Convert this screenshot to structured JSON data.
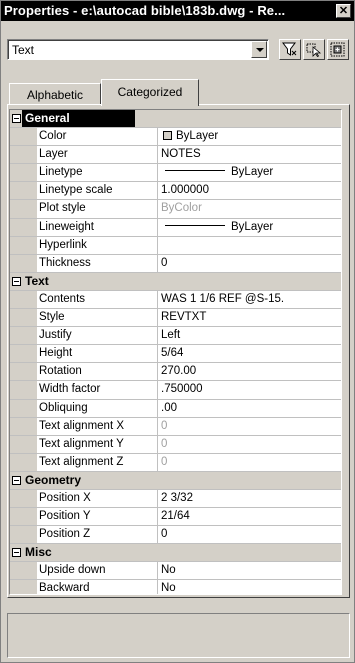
{
  "window": {
    "title": "Properties - e:\\autocad bible\\183b.dwg - Re...",
    "close_label": "✕"
  },
  "selector": {
    "value": "Text"
  },
  "toolbar": {
    "icons": [
      "quick-select-filter-icon",
      "select-objects-icon",
      "toggle-pickadd-icon"
    ]
  },
  "tabs": [
    {
      "label": "Alphabetic",
      "active": false
    },
    {
      "label": "Categorized",
      "active": true
    }
  ],
  "categories": [
    {
      "name": "General",
      "properties": [
        {
          "name": "Color",
          "value": "ByLayer",
          "kind": "color"
        },
        {
          "name": "Layer",
          "value": "NOTES"
        },
        {
          "name": "Linetype",
          "value": "ByLayer",
          "kind": "line"
        },
        {
          "name": "Linetype scale",
          "value": "1.000000"
        },
        {
          "name": "Plot style",
          "value": "ByColor",
          "gray": true
        },
        {
          "name": "Lineweight",
          "value": "ByLayer",
          "kind": "line"
        },
        {
          "name": "Hyperlink",
          "value": ""
        },
        {
          "name": "Thickness",
          "value": "0"
        }
      ]
    },
    {
      "name": "Text",
      "properties": [
        {
          "name": "Contents",
          "value": "WAS 1 1/6 REF @S-15."
        },
        {
          "name": "Style",
          "value": "REVTXT"
        },
        {
          "name": "Justify",
          "value": "Left"
        },
        {
          "name": "Height",
          "value": "5/64"
        },
        {
          "name": "Rotation",
          "value": "270.00"
        },
        {
          "name": "Width factor",
          "value": ".750000"
        },
        {
          "name": "Obliquing",
          "value": ".00"
        },
        {
          "name": "Text alignment X",
          "value": "0",
          "gray": true
        },
        {
          "name": "Text alignment Y",
          "value": "0",
          "gray": true
        },
        {
          "name": "Text alignment Z",
          "value": "0",
          "gray": true
        }
      ]
    },
    {
      "name": "Geometry",
      "properties": [
        {
          "name": "Position X",
          "value": "2 3/32"
        },
        {
          "name": "Position Y",
          "value": "21/64"
        },
        {
          "name": "Position Z",
          "value": "0"
        }
      ]
    },
    {
      "name": "Misc",
      "properties": [
        {
          "name": "Upside down",
          "value": "No"
        },
        {
          "name": "Backward",
          "value": "No"
        }
      ]
    }
  ]
}
